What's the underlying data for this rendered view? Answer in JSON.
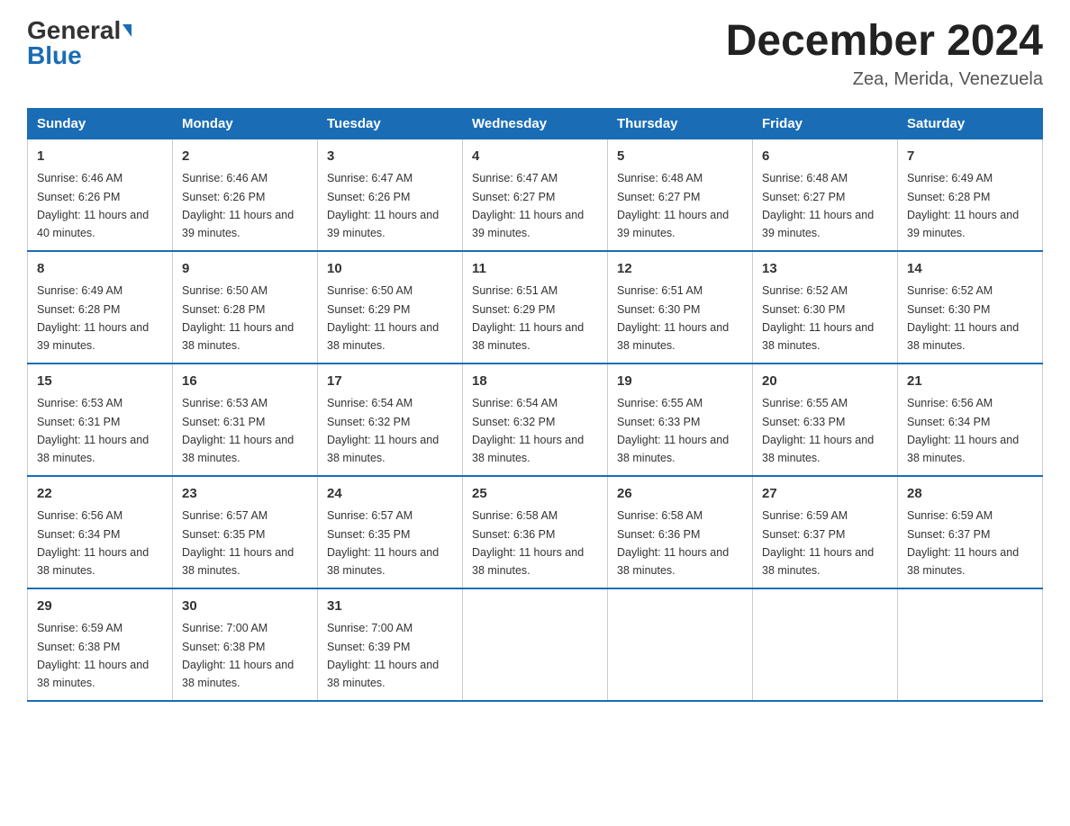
{
  "header": {
    "logo_general": "General",
    "logo_blue": "Blue",
    "month_title": "December 2024",
    "location": "Zea, Merida, Venezuela"
  },
  "days_of_week": [
    "Sunday",
    "Monday",
    "Tuesday",
    "Wednesday",
    "Thursday",
    "Friday",
    "Saturday"
  ],
  "weeks": [
    [
      {
        "day": "1",
        "sunrise": "6:46 AM",
        "sunset": "6:26 PM",
        "daylight": "11 hours and 40 minutes."
      },
      {
        "day": "2",
        "sunrise": "6:46 AM",
        "sunset": "6:26 PM",
        "daylight": "11 hours and 39 minutes."
      },
      {
        "day": "3",
        "sunrise": "6:47 AM",
        "sunset": "6:26 PM",
        "daylight": "11 hours and 39 minutes."
      },
      {
        "day": "4",
        "sunrise": "6:47 AM",
        "sunset": "6:27 PM",
        "daylight": "11 hours and 39 minutes."
      },
      {
        "day": "5",
        "sunrise": "6:48 AM",
        "sunset": "6:27 PM",
        "daylight": "11 hours and 39 minutes."
      },
      {
        "day": "6",
        "sunrise": "6:48 AM",
        "sunset": "6:27 PM",
        "daylight": "11 hours and 39 minutes."
      },
      {
        "day": "7",
        "sunrise": "6:49 AM",
        "sunset": "6:28 PM",
        "daylight": "11 hours and 39 minutes."
      }
    ],
    [
      {
        "day": "8",
        "sunrise": "6:49 AM",
        "sunset": "6:28 PM",
        "daylight": "11 hours and 39 minutes."
      },
      {
        "day": "9",
        "sunrise": "6:50 AM",
        "sunset": "6:28 PM",
        "daylight": "11 hours and 38 minutes."
      },
      {
        "day": "10",
        "sunrise": "6:50 AM",
        "sunset": "6:29 PM",
        "daylight": "11 hours and 38 minutes."
      },
      {
        "day": "11",
        "sunrise": "6:51 AM",
        "sunset": "6:29 PM",
        "daylight": "11 hours and 38 minutes."
      },
      {
        "day": "12",
        "sunrise": "6:51 AM",
        "sunset": "6:30 PM",
        "daylight": "11 hours and 38 minutes."
      },
      {
        "day": "13",
        "sunrise": "6:52 AM",
        "sunset": "6:30 PM",
        "daylight": "11 hours and 38 minutes."
      },
      {
        "day": "14",
        "sunrise": "6:52 AM",
        "sunset": "6:30 PM",
        "daylight": "11 hours and 38 minutes."
      }
    ],
    [
      {
        "day": "15",
        "sunrise": "6:53 AM",
        "sunset": "6:31 PM",
        "daylight": "11 hours and 38 minutes."
      },
      {
        "day": "16",
        "sunrise": "6:53 AM",
        "sunset": "6:31 PM",
        "daylight": "11 hours and 38 minutes."
      },
      {
        "day": "17",
        "sunrise": "6:54 AM",
        "sunset": "6:32 PM",
        "daylight": "11 hours and 38 minutes."
      },
      {
        "day": "18",
        "sunrise": "6:54 AM",
        "sunset": "6:32 PM",
        "daylight": "11 hours and 38 minutes."
      },
      {
        "day": "19",
        "sunrise": "6:55 AM",
        "sunset": "6:33 PM",
        "daylight": "11 hours and 38 minutes."
      },
      {
        "day": "20",
        "sunrise": "6:55 AM",
        "sunset": "6:33 PM",
        "daylight": "11 hours and 38 minutes."
      },
      {
        "day": "21",
        "sunrise": "6:56 AM",
        "sunset": "6:34 PM",
        "daylight": "11 hours and 38 minutes."
      }
    ],
    [
      {
        "day": "22",
        "sunrise": "6:56 AM",
        "sunset": "6:34 PM",
        "daylight": "11 hours and 38 minutes."
      },
      {
        "day": "23",
        "sunrise": "6:57 AM",
        "sunset": "6:35 PM",
        "daylight": "11 hours and 38 minutes."
      },
      {
        "day": "24",
        "sunrise": "6:57 AM",
        "sunset": "6:35 PM",
        "daylight": "11 hours and 38 minutes."
      },
      {
        "day": "25",
        "sunrise": "6:58 AM",
        "sunset": "6:36 PM",
        "daylight": "11 hours and 38 minutes."
      },
      {
        "day": "26",
        "sunrise": "6:58 AM",
        "sunset": "6:36 PM",
        "daylight": "11 hours and 38 minutes."
      },
      {
        "day": "27",
        "sunrise": "6:59 AM",
        "sunset": "6:37 PM",
        "daylight": "11 hours and 38 minutes."
      },
      {
        "day": "28",
        "sunrise": "6:59 AM",
        "sunset": "6:37 PM",
        "daylight": "11 hours and 38 minutes."
      }
    ],
    [
      {
        "day": "29",
        "sunrise": "6:59 AM",
        "sunset": "6:38 PM",
        "daylight": "11 hours and 38 minutes."
      },
      {
        "day": "30",
        "sunrise": "7:00 AM",
        "sunset": "6:38 PM",
        "daylight": "11 hours and 38 minutes."
      },
      {
        "day": "31",
        "sunrise": "7:00 AM",
        "sunset": "6:39 PM",
        "daylight": "11 hours and 38 minutes."
      },
      null,
      null,
      null,
      null
    ]
  ]
}
